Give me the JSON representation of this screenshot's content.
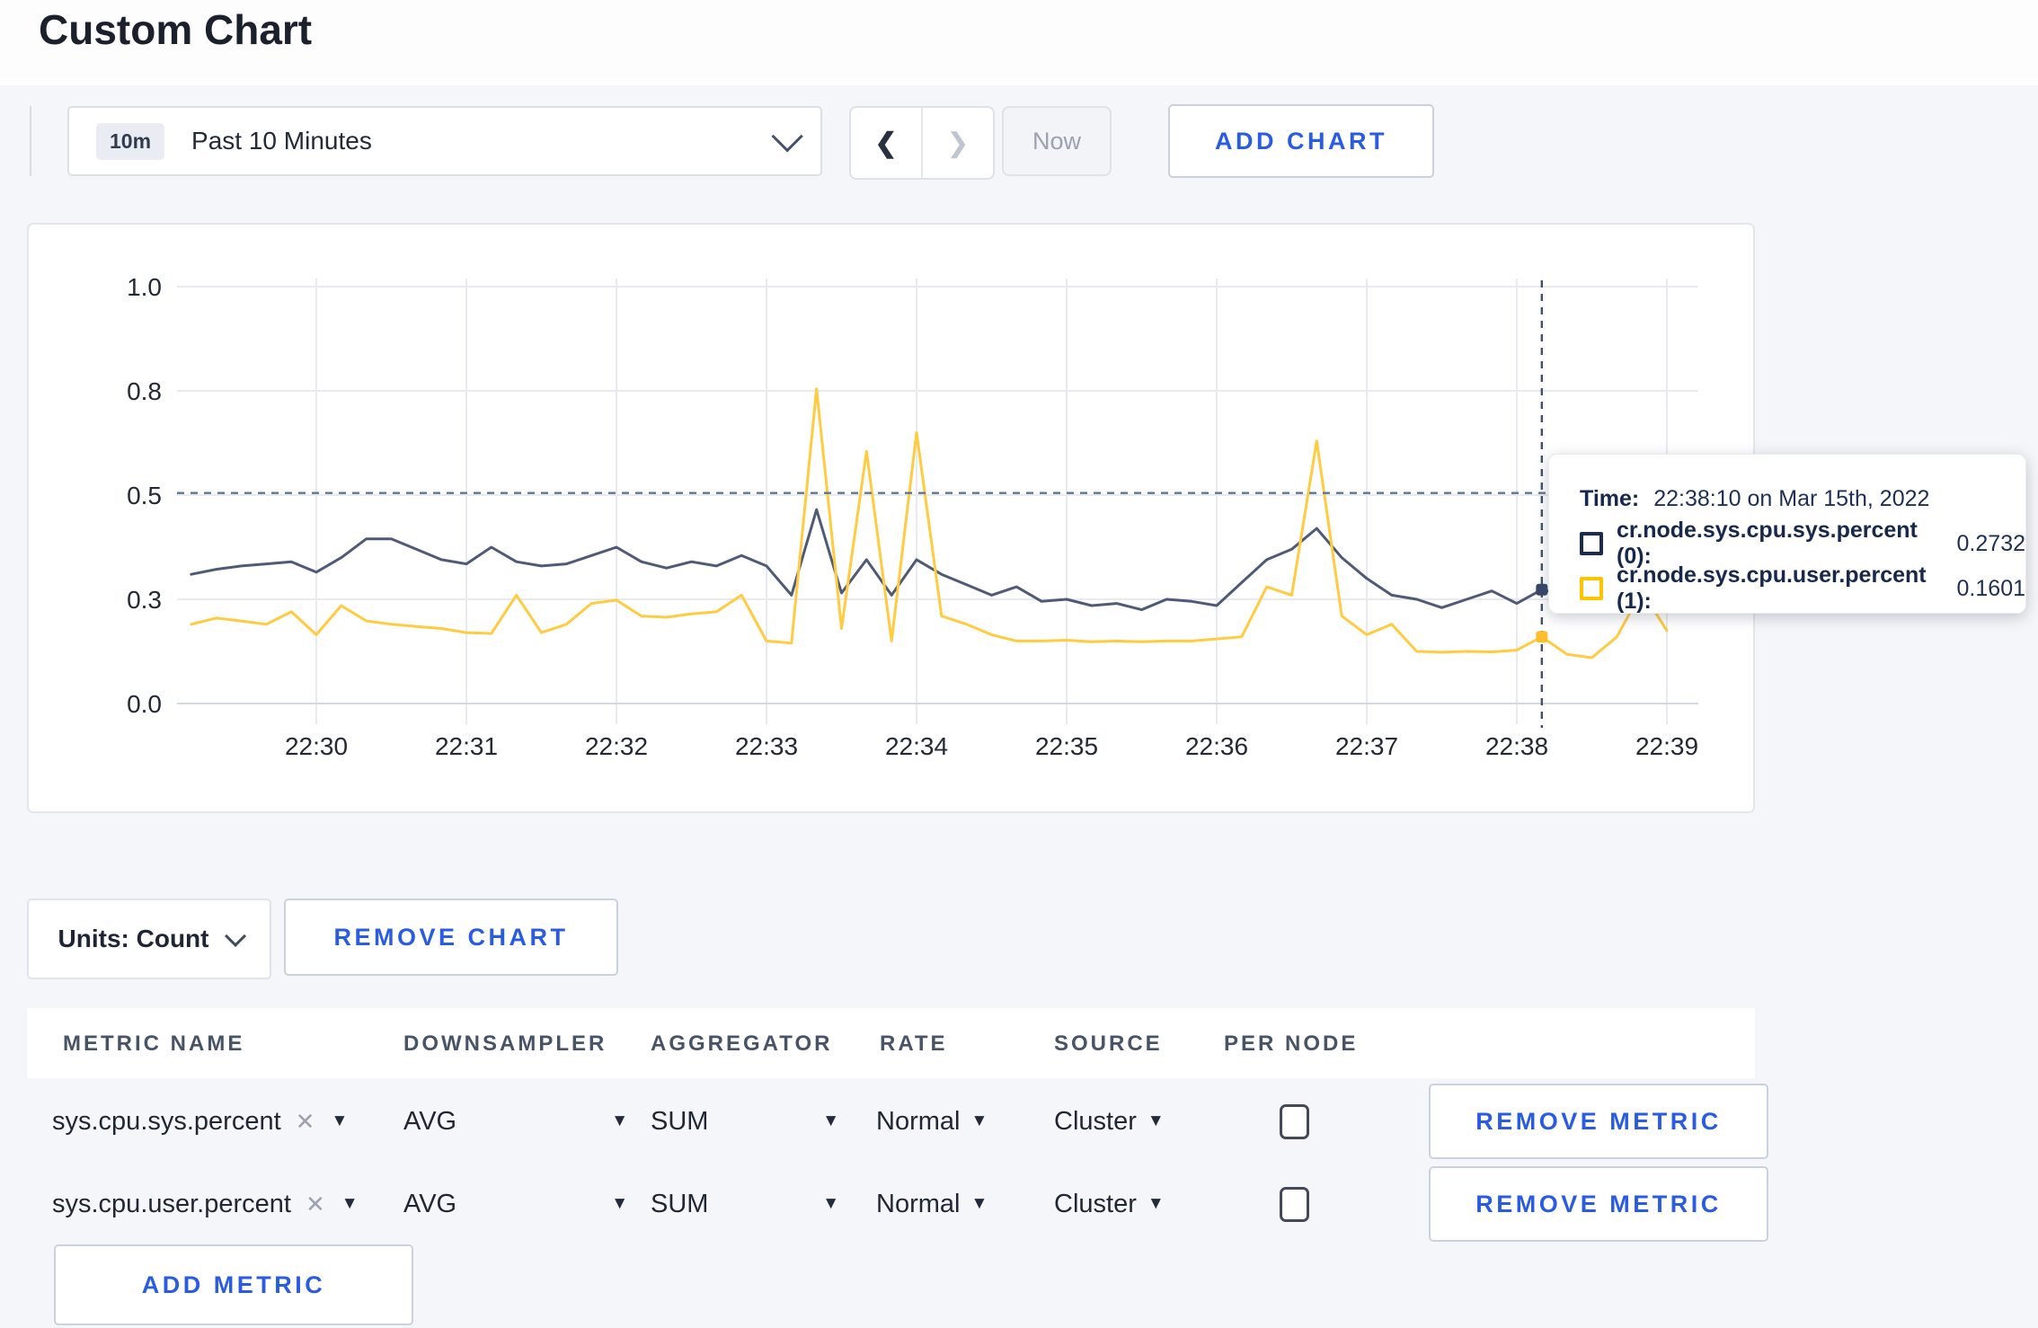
{
  "page": {
    "title": "Custom Chart"
  },
  "toolbar": {
    "time_badge": "10m",
    "time_label": "Past 10 Minutes",
    "prev_icon": "❮",
    "next_icon": "❯",
    "now_label": "Now",
    "add_chart_label": "ADD CHART"
  },
  "chart_controls": {
    "units_label": "Units: Count",
    "remove_chart_label": "REMOVE CHART",
    "add_metric_label": "ADD METRIC",
    "remove_metric_label": "REMOVE METRIC"
  },
  "tooltip": {
    "time_label": "Time:",
    "time_value": "22:38:10 on Mar 15th, 2022",
    "series": [
      {
        "label": "cr.node.sys.cpu.sys.percent (0):",
        "value": "0.2732",
        "color": "#1d2c4e"
      },
      {
        "label": "cr.node.sys.cpu.user.percent (1):",
        "value": "0.1601",
        "color": "#fdc400"
      }
    ]
  },
  "metrics_table": {
    "headers": [
      "METRIC NAME",
      "DOWNSAMPLER",
      "AGGREGATOR",
      "RATE",
      "SOURCE",
      "PER NODE"
    ],
    "remove_icon": "✕",
    "caret_icon": "▼",
    "rows": [
      {
        "metric": "sys.cpu.sys.percent",
        "downsampler": "AVG",
        "aggregator": "SUM",
        "rate": "Normal",
        "source": "Cluster",
        "per_node_checked": false
      },
      {
        "metric": "sys.cpu.user.percent",
        "downsampler": "AVG",
        "aggregator": "SUM",
        "rate": "Normal",
        "source": "Cluster",
        "per_node_checked": false
      }
    ]
  },
  "chart_data": {
    "type": "line",
    "title": "",
    "xlabel": "",
    "ylabel": "",
    "ylim": [
      0,
      1
    ],
    "grid": true,
    "legend_position": "none",
    "x_tick_labels": [
      "22:30",
      "22:31",
      "22:32",
      "22:33",
      "22:34",
      "22:35",
      "22:36",
      "22:37",
      "22:38",
      "22:39"
    ],
    "y_tick_labels": [
      "0.0",
      "0.3",
      "0.5",
      "0.8",
      "1.0"
    ],
    "y_tick_values": [
      0,
      0.25,
      0.5,
      0.75,
      1.0
    ],
    "times": [
      "22:29:10",
      "22:29:20",
      "22:29:30",
      "22:29:40",
      "22:29:50",
      "22:30:00",
      "22:30:10",
      "22:30:20",
      "22:30:30",
      "22:30:40",
      "22:30:50",
      "22:31:00",
      "22:31:10",
      "22:31:20",
      "22:31:30",
      "22:31:40",
      "22:31:50",
      "22:32:00",
      "22:32:10",
      "22:32:20",
      "22:32:30",
      "22:32:40",
      "22:32:50",
      "22:33:00",
      "22:33:10",
      "22:33:20",
      "22:33:30",
      "22:33:40",
      "22:33:50",
      "22:34:00",
      "22:34:10",
      "22:34:20",
      "22:34:30",
      "22:34:40",
      "22:34:50",
      "22:35:00",
      "22:35:10",
      "22:35:20",
      "22:35:30",
      "22:35:40",
      "22:35:50",
      "22:36:00",
      "22:36:10",
      "22:36:20",
      "22:36:30",
      "22:36:40",
      "22:36:50",
      "22:37:00",
      "22:37:10",
      "22:37:20",
      "22:37:30",
      "22:37:40",
      "22:37:50",
      "22:38:00",
      "22:38:10",
      "22:38:20",
      "22:38:30",
      "22:38:40",
      "22:38:50",
      "22:39:00"
    ],
    "series": [
      {
        "name": "cr.node.sys.cpu.sys.percent",
        "color": "#4e5a76",
        "dot_color": "#38476a",
        "values": [
          0.31,
          0.322,
          0.33,
          0.335,
          0.34,
          0.315,
          0.35,
          0.395,
          0.395,
          0.37,
          0.345,
          0.335,
          0.375,
          0.34,
          0.33,
          0.335,
          0.355,
          0.375,
          0.34,
          0.325,
          0.34,
          0.33,
          0.355,
          0.33,
          0.26,
          0.465,
          0.265,
          0.345,
          0.26,
          0.345,
          0.31,
          0.285,
          0.26,
          0.28,
          0.245,
          0.25,
          0.235,
          0.24,
          0.225,
          0.25,
          0.245,
          0.235,
          0.29,
          0.345,
          0.37,
          0.42,
          0.35,
          0.3,
          0.26,
          0.25,
          0.23,
          0.25,
          0.27,
          0.24,
          0.2732,
          0.26,
          0.25,
          0.26,
          0.27,
          0.26
        ]
      },
      {
        "name": "cr.node.sys.cpu.user.percent",
        "color": "#ffcb40",
        "dot_color": "#fdbe2e",
        "values": [
          0.19,
          0.205,
          0.198,
          0.19,
          0.22,
          0.165,
          0.235,
          0.198,
          0.19,
          0.185,
          0.18,
          0.17,
          0.168,
          0.26,
          0.17,
          0.19,
          0.24,
          0.248,
          0.21,
          0.207,
          0.215,
          0.22,
          0.26,
          0.15,
          0.145,
          0.755,
          0.18,
          0.605,
          0.15,
          0.65,
          0.21,
          0.19,
          0.165,
          0.15,
          0.15,
          0.152,
          0.148,
          0.15,
          0.148,
          0.15,
          0.15,
          0.155,
          0.16,
          0.28,
          0.26,
          0.63,
          0.21,
          0.165,
          0.19,
          0.125,
          0.123,
          0.125,
          0.124,
          0.128,
          0.1601,
          0.118,
          0.11,
          0.16,
          0.27,
          0.175
        ]
      }
    ],
    "crosshair": {
      "time": "22:38:10",
      "hline_value": 0.505,
      "values": [
        0.2732,
        0.1601
      ]
    }
  }
}
